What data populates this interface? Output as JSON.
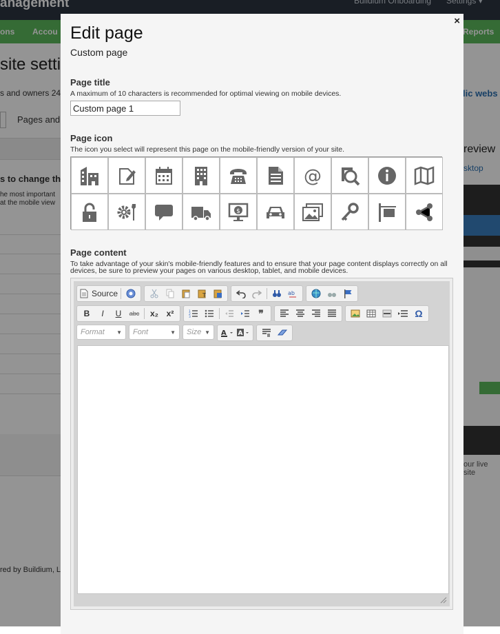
{
  "background": {
    "brand": "anagement",
    "top_nav": [
      "Buildium Onboarding",
      "Settings ▾"
    ],
    "main_nav": [
      "ons",
      "Accou",
      "Reports"
    ],
    "heading": "site setti",
    "owners_text": "s and owners 24",
    "tab_label": "Pages and",
    "change_heading": "s to change the",
    "important_text": "he most important",
    "mobile_view_text": "at the mobile view",
    "public_web_text": "lic webs",
    "preview_text": "review",
    "desktop_text": "sktop",
    "live_site_text": "our live site",
    "footer_text": "red by Buildium, LL"
  },
  "modal": {
    "close_label": "×",
    "title": "Edit page",
    "subtitle": "Custom page",
    "page_title": {
      "label": "Page title",
      "help": "A maximum of 10 characters is recommended for optimal viewing on mobile devices.",
      "value": "Custom page 1"
    },
    "page_icon": {
      "label": "Page icon",
      "help": "The icon you select will represent this page on the mobile-friendly version of your site.",
      "icons": [
        "building-home-icon",
        "edit-document-icon",
        "calendar-icon",
        "office-building-icon",
        "telephone-icon",
        "document-icon",
        "at-sign-icon",
        "search-document-icon",
        "info-icon",
        "map-icon",
        "unlock-icon",
        "settings-tools-icon",
        "speech-bubble-icon",
        "truck-icon",
        "monitor-dollar-icon",
        "car-icon",
        "photos-icon",
        "key-icon",
        "sign-post-icon",
        "share-icon"
      ]
    },
    "page_content": {
      "label": "Page content",
      "help": "To take advantage of your skin's mobile-friendly features and to ensure that your page content displays correctly on all devices, be sure to preview your pages on various desktop, tablet, and mobile devices."
    },
    "editor": {
      "source_label": "Source",
      "format_label": "Format",
      "font_label": "Font",
      "size_label": "Size",
      "bold": "B",
      "italic": "I",
      "underline": "U",
      "strike": "abc",
      "subscript": "x₂",
      "superscript": "x²",
      "quote": "❞",
      "omega": "Ω",
      "content": ""
    }
  }
}
